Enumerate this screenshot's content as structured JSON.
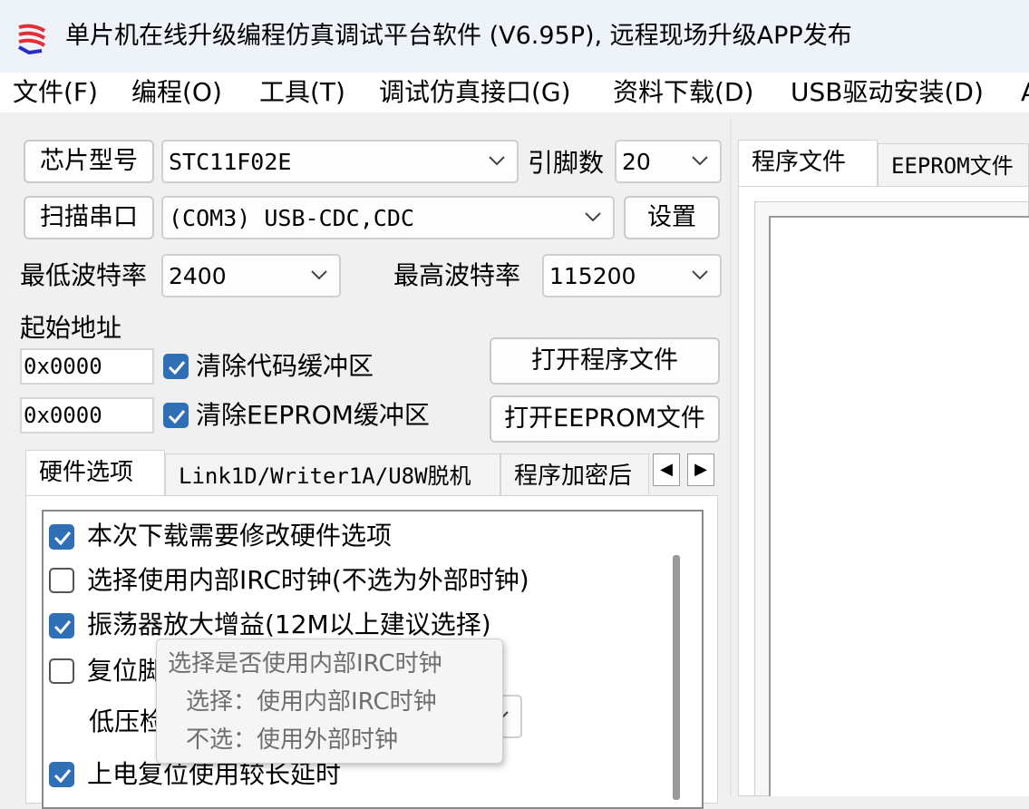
{
  "window": {
    "title": "单片机在线升级编程仿真调试平台软件 (V6.95P), 远程现场升级APP发布"
  },
  "menu": [
    "文件(F)",
    "编程(O)",
    "工具(T)",
    "调试仿真接口(G)",
    "资料下载(D)",
    "USB驱动安装(D)",
    "A"
  ],
  "chip": {
    "button": "芯片型号",
    "value": "STC11F02E",
    "pins_label": "引脚数",
    "pins_value": "20"
  },
  "port": {
    "scan_button": "扫描串口",
    "value": "(COM3) USB-CDC,CDC",
    "settings_button": "设置"
  },
  "baud": {
    "min_label": "最低波特率",
    "min_value": "2400",
    "max_label": "最高波特率",
    "max_value": "115200"
  },
  "address": {
    "label": "起始地址",
    "code_start": "0x0000",
    "eeprom_start": "0x0000",
    "clear_code": "清除代码缓冲区",
    "clear_eeprom": "清除EEPROM缓冲区",
    "open_program": "打开程序文件",
    "open_eeprom": "打开EEPROM文件"
  },
  "tabs": [
    "硬件选项",
    "Link1D/Writer1A/U8W脱机",
    "程序加密后"
  ],
  "options": [
    {
      "label": "本次下载需要修改硬件选项",
      "checked": true
    },
    {
      "label": "选择使用内部IRC时钟(不选为外部时钟)",
      "checked": false
    },
    {
      "label": "振荡器放大增益(12M以上建议选择)",
      "checked": true
    },
    {
      "label": "复位脚",
      "checked": false
    },
    {
      "label": "低压检",
      "checked": null
    },
    {
      "label": "上电复位使用较长延时",
      "checked": true
    }
  ],
  "tooltip": {
    "line1": "选择是否使用内部IRC时钟",
    "line2": "选择：使用内部IRC时钟",
    "line3": "不选：使用外部时钟"
  },
  "right_tabs": [
    "程序文件",
    "EEPROM文件"
  ],
  "colors": {
    "accent": "#2f6fb5",
    "titlebar": "#eef3f9"
  }
}
